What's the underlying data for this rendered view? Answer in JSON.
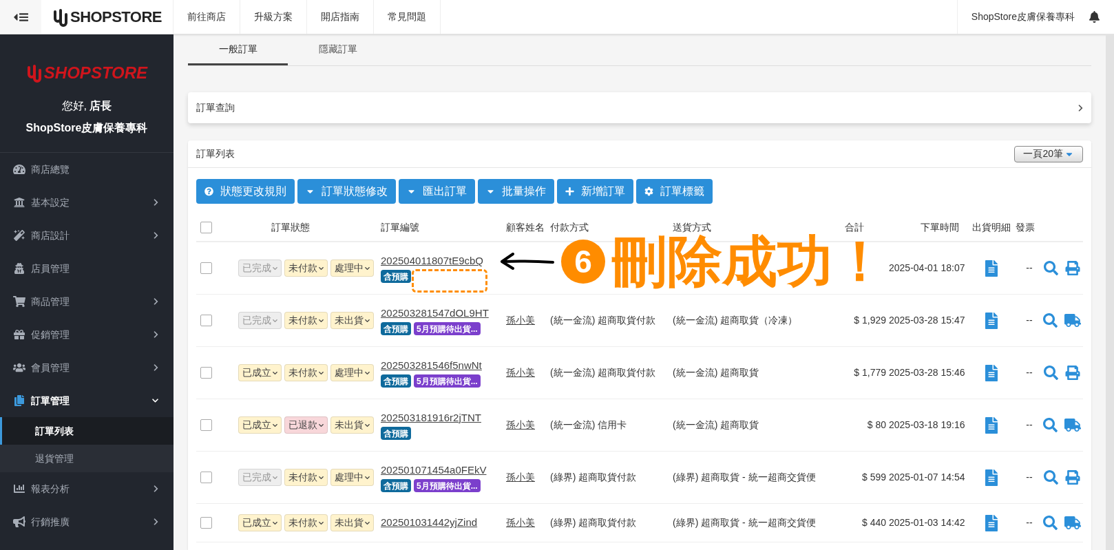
{
  "topbar": {
    "logo": "SHOPSTORE",
    "nav": [
      "前往商店",
      "升級方案",
      "開店指南",
      "常見問題"
    ],
    "store_name": "ShopStore皮膚保養專科"
  },
  "sidebar": {
    "logo": "SHOPSTORE",
    "greeting": "您好, **店長**",
    "store_name": "ShopStore皮膚保養專科",
    "items": [
      {
        "label": "商店總覽",
        "kind": "gauge",
        "chevron": false,
        "expanded": false,
        "selected": false
      },
      {
        "label": "基本設定",
        "kind": "bank",
        "chevron": true,
        "expanded": false,
        "selected": false
      },
      {
        "label": "商店設計",
        "kind": "wand",
        "chevron": true,
        "expanded": false,
        "selected": false
      },
      {
        "label": "店員管理",
        "kind": "agent",
        "chevron": false,
        "expanded": false,
        "selected": false
      },
      {
        "label": "商品管理",
        "kind": "cart",
        "chevron": true,
        "expanded": false,
        "selected": false
      },
      {
        "label": "促銷管理",
        "kind": "gift",
        "chevron": true,
        "expanded": false,
        "selected": false
      },
      {
        "label": "會員管理",
        "kind": "users",
        "chevron": true,
        "expanded": false,
        "selected": false
      },
      {
        "label": "訂單管理",
        "kind": "copy",
        "chevron": true,
        "expanded": true,
        "selected": true,
        "children": [
          {
            "label": "訂單列表",
            "selected": true
          },
          {
            "label": "退貨管理",
            "selected": false
          }
        ]
      },
      {
        "label": "報表分析",
        "kind": "chart",
        "chevron": true,
        "expanded": false,
        "selected": false
      },
      {
        "label": "行銷推廣",
        "kind": "bullhorn",
        "chevron": true,
        "expanded": false,
        "selected": false
      }
    ]
  },
  "tabs": [
    {
      "label": "一般訂單",
      "selected": true
    },
    {
      "label": "隱藏訂單",
      "selected": false
    }
  ],
  "query_panel": {
    "title": "訂單查詢"
  },
  "order_list": {
    "title": "訂單列表",
    "page_size": "一頁20筆",
    "buttons": [
      {
        "label": "狀態更改規則",
        "kind": "question"
      },
      {
        "label": "訂單狀態修改",
        "kind": "caret"
      },
      {
        "label": "匯出訂單",
        "kind": "caret"
      },
      {
        "label": "批量操作",
        "kind": "caret"
      },
      {
        "label": "新增訂單",
        "kind": "plus"
      },
      {
        "label": "訂單標籤",
        "kind": "gear"
      }
    ],
    "select_all_checked": false,
    "columns": [
      "訂單狀態",
      "訂單編號",
      "顧客姓名",
      "付款方式",
      "送貨方式",
      "合計",
      "下單時間",
      "出貨明細",
      "發票"
    ],
    "rows": [
      {
        "statuses": [
          {
            "label": "已完成",
            "color": "#eeeeee",
            "disabled": true
          },
          {
            "label": "未付款",
            "color": "#fff3cd",
            "disabled": false
          },
          {
            "label": "處理中",
            "color": "#fff3cd",
            "disabled": false
          }
        ],
        "order_no": "202504011807tE9cbQ",
        "tags": [
          {
            "label": "含預購",
            "color": "#0f6a9c"
          }
        ],
        "checked": false,
        "date": "2025-04-01 18:07",
        "invoice": "--",
        "kind": "print"
      },
      {
        "statuses": [
          {
            "label": "已完成",
            "color": "#eeeeee",
            "disabled": true
          },
          {
            "label": "未付款",
            "color": "#fff3cd",
            "disabled": false
          },
          {
            "label": "未出貨",
            "color": "#fff3cd",
            "disabled": false
          }
        ],
        "order_no": "202503281547dOL9HT",
        "tags": [
          {
            "label": "含預購",
            "color": "#0f6a9c"
          },
          {
            "label": "5月預購待出貨...",
            "color": "#7b3fcc"
          }
        ],
        "checked": false,
        "customer": "孫小美",
        "payment": "(統一金流) 超商取貨付款",
        "shipping": "(統一金流) 超商取貨（冷凍）",
        "total": "$ 1,929",
        "date": "2025-03-28 15:47",
        "invoice": "--",
        "kind": "truck"
      },
      {
        "statuses": [
          {
            "label": "已成立",
            "color": "#fff3cd",
            "disabled": false
          },
          {
            "label": "未付款",
            "color": "#fff3cd",
            "disabled": false
          },
          {
            "label": "處理中",
            "color": "#fff3cd",
            "disabled": false
          }
        ],
        "order_no": "202503281546f5nwNt",
        "tags": [
          {
            "label": "含預購",
            "color": "#0f6a9c"
          },
          {
            "label": "5月預購待出貨...",
            "color": "#7b3fcc"
          }
        ],
        "checked": false,
        "customer": "孫小美",
        "payment": "(統一金流) 超商取貨付款",
        "shipping": "(統一金流) 超商取貨",
        "total": "$ 1,779",
        "date": "2025-03-28 15:46",
        "invoice": "--",
        "kind": "print"
      },
      {
        "statuses": [
          {
            "label": "已成立",
            "color": "#fff3cd",
            "disabled": false
          },
          {
            "label": "已退款",
            "color": "#f8d7da",
            "disabled": false
          },
          {
            "label": "未出貨",
            "color": "#fff3cd",
            "disabled": false
          }
        ],
        "order_no": "202503181916r2jTNT",
        "tags": [
          {
            "label": "含預購",
            "color": "#0f6a9c"
          }
        ],
        "checked": false,
        "customer": "孫小美",
        "payment": "(統一金流) 信用卡",
        "shipping": "(統一金流) 超商取貨",
        "total": "$ 80",
        "date": "2025-03-18 19:16",
        "invoice": "--",
        "kind": "truck"
      },
      {
        "statuses": [
          {
            "label": "已完成",
            "color": "#eeeeee",
            "disabled": true
          },
          {
            "label": "未付款",
            "color": "#fff3cd",
            "disabled": false
          },
          {
            "label": "處理中",
            "color": "#fff3cd",
            "disabled": false
          }
        ],
        "order_no": "202501071454a0FEkV",
        "tags": [
          {
            "label": "含預購",
            "color": "#0f6a9c"
          },
          {
            "label": "5月預購待出貨...",
            "color": "#7b3fcc"
          }
        ],
        "checked": false,
        "customer": "孫小美",
        "payment": "(綠界) 超商取貨付款",
        "shipping": "(綠界) 超商取貨 - 統一超商交貨便",
        "total": "$ 599",
        "date": "2025-01-07 14:54",
        "invoice": "--",
        "kind": "print"
      },
      {
        "statuses": [
          {
            "label": "已成立",
            "color": "#fff3cd",
            "disabled": false
          },
          {
            "label": "未付款",
            "color": "#fff3cd",
            "disabled": false
          },
          {
            "label": "未出貨",
            "color": "#fff3cd",
            "disabled": false
          }
        ],
        "order_no": "202501031442yjZind",
        "tags": [],
        "checked": false,
        "customer": "孫小美",
        "payment": "(綠界) 超商取貨付款",
        "shipping": "(綠界) 超商取貨 - 統一超商交貨便",
        "total": "$ 440",
        "date": "2025-01-03 14:42",
        "invoice": "--",
        "kind": "truck"
      }
    ]
  },
  "annotation": {
    "number": "6",
    "text": "刪除成功！"
  }
}
